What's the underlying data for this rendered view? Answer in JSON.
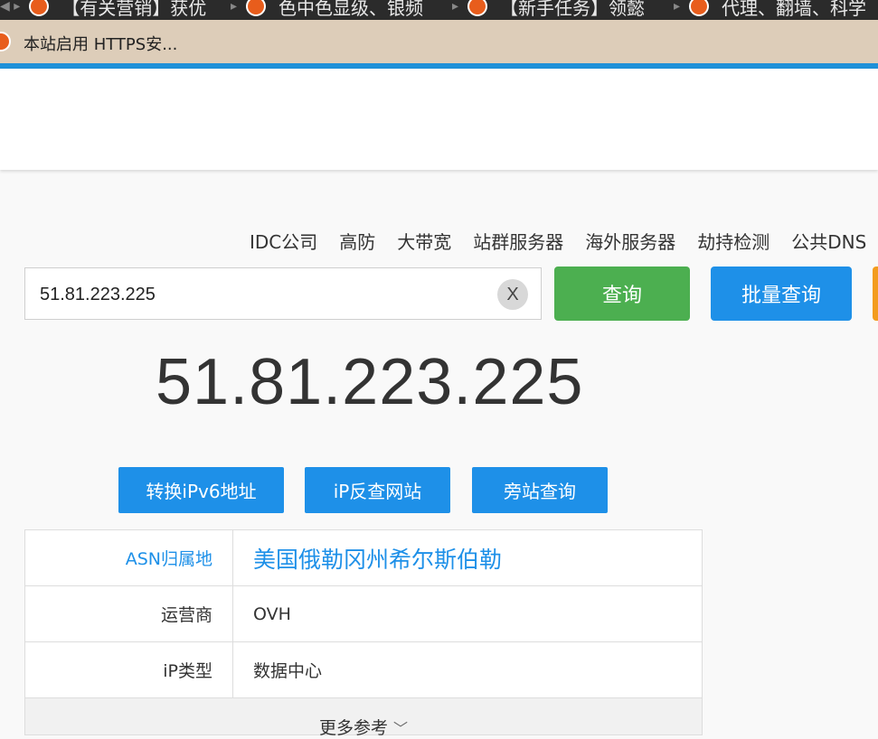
{
  "browser": {
    "tabs": [
      {
        "label": "【有关营销】获优"
      },
      {
        "label": "色中色显级、银频"
      },
      {
        "label": "【新手任务】领懿"
      },
      {
        "label": "代理、翻墙、科学"
      }
    ],
    "notice_text": "本站启用 HTTPS安..."
  },
  "nav": {
    "links": [
      "IDC公司",
      "高防",
      "大带宽",
      "站群服务器",
      "海外服务器",
      "劫持检测",
      "公共DNS"
    ]
  },
  "search": {
    "value": "51.81.223.225",
    "clear_label": "X",
    "query_label": "查询",
    "batch_label": "批量查询"
  },
  "result": {
    "ip": "51.81.223.225",
    "actions": [
      "转换iPv6地址",
      "iP反查网站",
      "旁站查询"
    ],
    "rows": [
      {
        "key": "ASN归属地",
        "value": "美国俄勒冈州希尔斯伯勒"
      },
      {
        "key": "运营商",
        "value": "OVH"
      },
      {
        "key": "iP类型",
        "value": "数据中心"
      }
    ],
    "more_label": "更多参考"
  },
  "colors": {
    "accent": "#1e90e8",
    "query_button": "#4caf50",
    "orange_button": "#f39c1e"
  }
}
